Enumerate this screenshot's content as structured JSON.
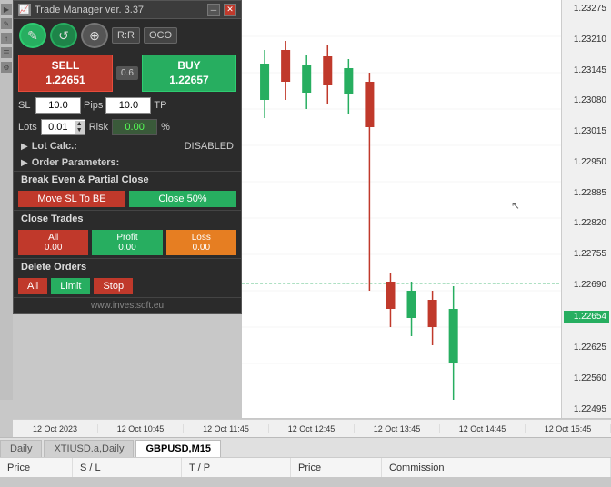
{
  "panel": {
    "title": "Trade Manager ver. 3.37",
    "toolbar": {
      "icons": [
        "✎",
        "↺",
        "⊕",
        "R:R",
        "OCO"
      ]
    },
    "sell": {
      "label": "SELL",
      "price": "1.22651"
    },
    "buy": {
      "label": "BUY",
      "price": "1.22657"
    },
    "spread": "0.6",
    "sl_value": "10.0",
    "tp_value": "10.0",
    "pips_label": "Pips",
    "lots_label": "Lots",
    "lots_value": "0.01",
    "risk_label": "Risk",
    "risk_value": "0.00",
    "risk_pct": "%",
    "lot_calc_label": "Lot Calc.:",
    "lot_calc_value": "DISABLED",
    "order_params_label": "Order Parameters:",
    "break_even_header": "Break Even & Partial Close",
    "move_sl_label": "Move SL To BE",
    "close50_label": "Close 50%",
    "close_trades_header": "Close Trades",
    "close_all_label": "All",
    "close_all_sub": "0.00",
    "close_profit_label": "Profit",
    "close_profit_sub": "0.00",
    "close_loss_label": "Loss",
    "close_loss_sub": "0.00",
    "delete_orders_header": "Delete Orders",
    "del_all_label": "All",
    "del_limit_label": "Limit",
    "del_stop_label": "Stop",
    "footer": "www.investsoft.eu"
  },
  "chart": {
    "prices": [
      "1.23275",
      "1.23210",
      "1.23145",
      "1.23080",
      "1.23015",
      "1.22950",
      "1.22885",
      "1.22820",
      "1.22755",
      "1.22690",
      "1.22654",
      "1.22625",
      "1.22560",
      "1.22495"
    ],
    "highlighted_price": "1.22654"
  },
  "timeline": {
    "labels": [
      "12 Oct 2023",
      "12 Oct 10:45",
      "12 Oct 11:45",
      "12 Oct 12:45",
      "12 Oct 13:45",
      "12 Oct 14:45",
      "12 Oct 15:45"
    ]
  },
  "tabs": [
    {
      "label": "Daily",
      "active": false
    },
    {
      "label": "XTIUSD.a,Daily",
      "active": false
    },
    {
      "label": "GBPUSD,M15",
      "active": true
    }
  ],
  "table_headers": {
    "col1": "Price",
    "col2": "S / L",
    "col3": "T / P",
    "col4": "Price",
    "col5": "Commission"
  }
}
